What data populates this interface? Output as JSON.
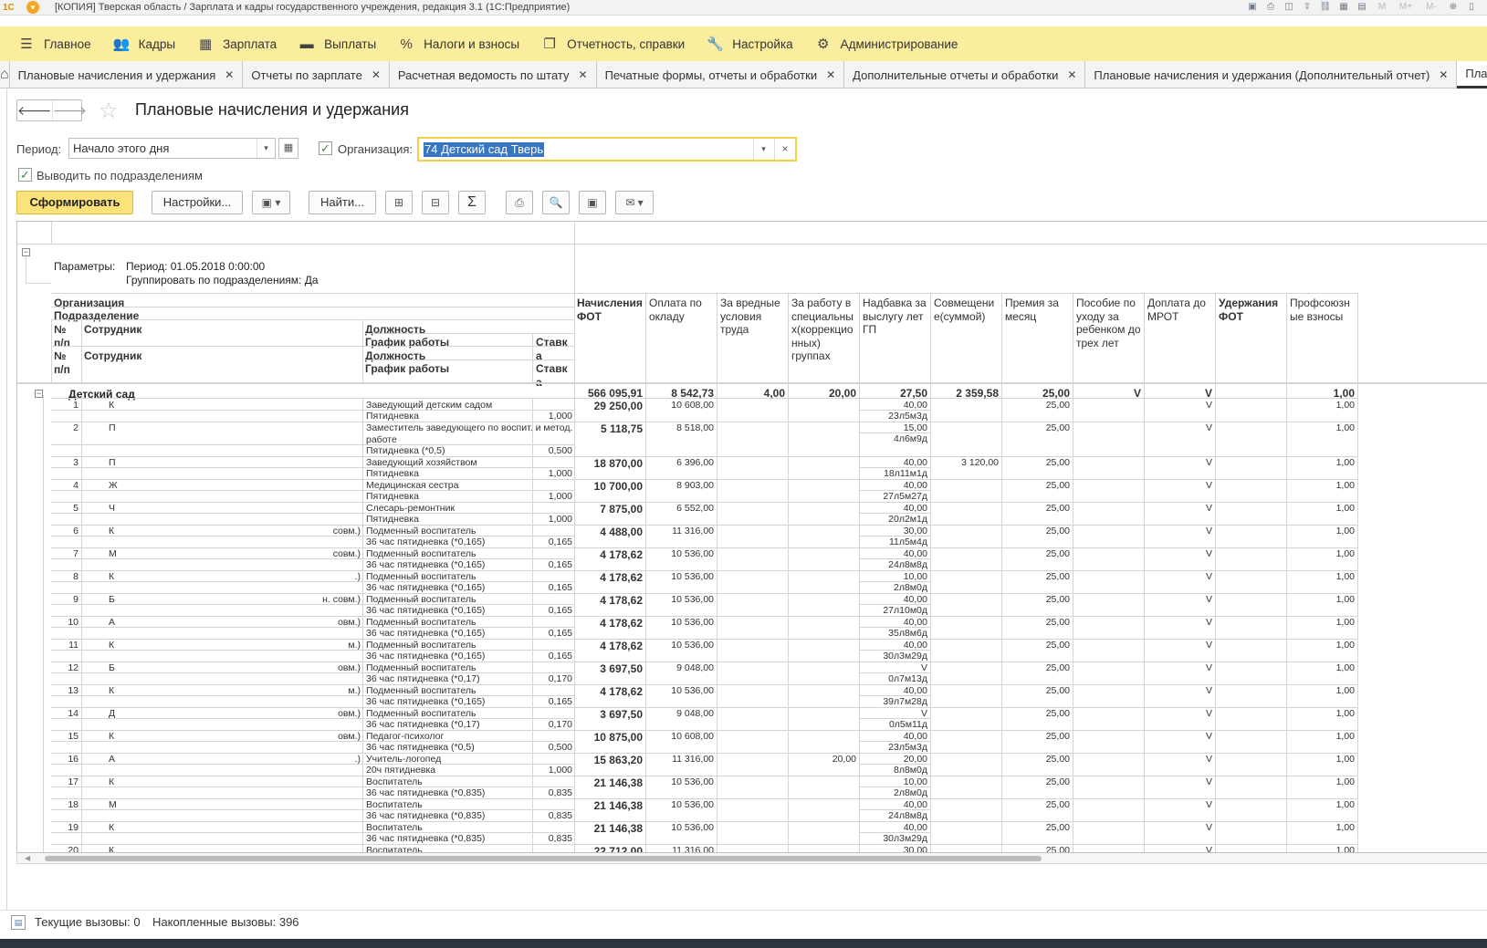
{
  "window": {
    "title": "[КОПИЯ] Тверская область / Зарплата и кадры государственного учреждения, редакция 3.1  (1С:Предприятие)",
    "logo": "1С",
    "toolbar_labels": {
      "m": "M",
      "mplus": "M+",
      "mminus": "M-"
    }
  },
  "main_menu": [
    {
      "label": "Главное",
      "icon": "hamburger-icon"
    },
    {
      "label": "Кадры",
      "icon": "people-icon"
    },
    {
      "label": "Зарплата",
      "icon": "calculator-icon"
    },
    {
      "label": "Выплаты",
      "icon": "wallet-icon"
    },
    {
      "label": "Налоги и взносы",
      "icon": "percent-icon"
    },
    {
      "label": "Отчетность, справки",
      "icon": "report-icon"
    },
    {
      "label": "Настройка",
      "icon": "wrench-icon"
    },
    {
      "label": "Администрирование",
      "icon": "gear-icon"
    }
  ],
  "tabs": [
    {
      "label": "Плановые начисления и удержания"
    },
    {
      "label": "Отчеты по зарплате"
    },
    {
      "label": "Расчетная ведомость по штату"
    },
    {
      "label": "Печатные формы, отчеты и обработки"
    },
    {
      "label": "Дополнительные отчеты и обработки"
    },
    {
      "label": "Плановые начисления и удержания (Дополнительный отчет)"
    },
    {
      "label": "Планов"
    }
  ],
  "form": {
    "title": "Плановые начисления и удержания",
    "period_label": "Период:",
    "period_value": "Начало этого дня",
    "org_label": "Организация:",
    "org_value": "74 Детский сад Тверь",
    "by_department_label": "Выводить по подразделениям"
  },
  "buttons": {
    "generate": "Сформировать",
    "settings": "Настройки...",
    "find": "Найти...",
    "sum_symbol": "Σ"
  },
  "report": {
    "params_label": "Параметры:",
    "params_period": "Период: 01.05.2018 0:00:00",
    "params_group": "Группировать по подразделениям: Да",
    "hdr_left": {
      "org": "Организация",
      "department": "Подразделение",
      "num1": "№ п/п",
      "employee1": "Сотрудник",
      "position1": "Должность",
      "schedule1": "График работы",
      "rate1": "Ставк а",
      "num2": "№ п/п",
      "employee2": "Сотрудник",
      "position2": "Должность",
      "schedule2": "График работы",
      "rate2": "Ставк а"
    },
    "columns": [
      "Начисления ФОТ",
      "Оплата по окладу",
      "За вредные условия труда",
      "За работу в специальны х(коррекцио нных) группах",
      "Надбавка за выслугу лет ГП",
      "Совмещени е(суммой)",
      "Премия за месяц",
      "Пособие по уходу за ребенком до трех лет",
      "Доплата до МРОТ",
      "Удержания ФОТ",
      "Профсоюзн ые взносы"
    ],
    "group": {
      "name": "Детский сад",
      "values": [
        "566 095,91",
        "8 542,73",
        "4,00",
        "20,00",
        "27,50",
        "2 359,58",
        "25,00",
        "V",
        "V",
        "",
        "1,00"
      ]
    },
    "rows": [
      {
        "n": "1",
        "e": "К",
        "p": "Заведующий детским садом",
        "s": "Пятидневка",
        "r": "1,000",
        "v": [
          "29 250,00",
          "10 608,00",
          "",
          "",
          "40,00",
          "",
          "25,00",
          "",
          "V",
          "",
          "1,00"
        ],
        "t": "23л5м3д"
      },
      {
        "n": "2",
        "e": "П",
        "p": "Заместитель заведующего по воспит. и метод. работе",
        "s": "Пятидневка (*0,5)",
        "r": "0,500",
        "v": [
          "5 118,75",
          "8 518,00",
          "",
          "",
          "15,00",
          "",
          "25,00",
          "",
          "V",
          "",
          "1,00"
        ],
        "t": "4л6м9д"
      },
      {
        "n": "3",
        "e": "П",
        "p": "Заведующий хозяйством",
        "s": "Пятидневка",
        "r": "1,000",
        "v": [
          "18 870,00",
          "6 396,00",
          "",
          "",
          "40,00",
          "3 120,00",
          "25,00",
          "",
          "V",
          "",
          "1,00"
        ],
        "t": "18л11м1д"
      },
      {
        "n": "4",
        "e": "Ж",
        "p": "Медицинская сестра",
        "s": "Пятидневка",
        "r": "1,000",
        "v": [
          "10 700,00",
          "8 903,00",
          "",
          "",
          "40,00",
          "",
          "25,00",
          "",
          "V",
          "",
          "1,00"
        ],
        "t": "27л5м27д"
      },
      {
        "n": "5",
        "e": "Ч",
        "p": "Слесарь-ремонтник",
        "s": "Пятидневка",
        "r": "1,000",
        "v": [
          "7 875,00",
          "6 552,00",
          "",
          "",
          "40,00",
          "",
          "25,00",
          "",
          "V",
          "",
          "1,00"
        ],
        "t": "20л2м1д"
      },
      {
        "n": "6",
        "e": "К",
        "x": "совм.)",
        "p": "Подменный воспитатель",
        "s": "36 час пятидневка (*0,165)",
        "r": "0,165",
        "v": [
          "4 488,00",
          "11 316,00",
          "",
          "",
          "30,00",
          "",
          "25,00",
          "",
          "V",
          "",
          "1,00"
        ],
        "t": "11л5м4д"
      },
      {
        "n": "7",
        "e": "М",
        "x": "совм.)",
        "p": "Подменный воспитатель",
        "s": "36 час пятидневка (*0,165)",
        "r": "0,165",
        "v": [
          "4 178,62",
          "10 536,00",
          "",
          "",
          "40,00",
          "",
          "25,00",
          "",
          "V",
          "",
          "1,00"
        ],
        "t": "24л8м8д"
      },
      {
        "n": "8",
        "e": "К",
        "x": ".)",
        "p": "Подменный воспитатель",
        "s": "36 час пятидневка (*0,165)",
        "r": "0,165",
        "v": [
          "4 178,62",
          "10 536,00",
          "",
          "",
          "10,00",
          "",
          "25,00",
          "",
          "V",
          "",
          "1,00"
        ],
        "t": "2л8м0д"
      },
      {
        "n": "9",
        "e": "Б",
        "x": "н. совм.)",
        "p": "Подменный воспитатель",
        "s": "36 час пятидневка (*0,165)",
        "r": "0,165",
        "v": [
          "4 178,62",
          "10 536,00",
          "",
          "",
          "40,00",
          "",
          "25,00",
          "",
          "V",
          "",
          "1,00"
        ],
        "t": "27л10м0д"
      },
      {
        "n": "10",
        "e": "А",
        "x": "овм.)",
        "p": "Подменный воспитатель",
        "s": "36 час пятидневка (*0,165)",
        "r": "0,165",
        "v": [
          "4 178,62",
          "10 536,00",
          "",
          "",
          "40,00",
          "",
          "25,00",
          "",
          "V",
          "",
          "1,00"
        ],
        "t": "35л8м6д"
      },
      {
        "n": "11",
        "e": "К",
        "x": "м.)",
        "p": "Подменный воспитатель",
        "s": "36 час пятидневка (*0,165)",
        "r": "0,165",
        "v": [
          "4 178,62",
          "10 536,00",
          "",
          "",
          "40,00",
          "",
          "25,00",
          "",
          "V",
          "",
          "1,00"
        ],
        "t": "30л3м29д"
      },
      {
        "n": "12",
        "e": "Б",
        "x": "овм.)",
        "p": "Подменный воспитатель",
        "s": "36 час пятидневка (*0,17)",
        "r": "0,170",
        "v": [
          "3 697,50",
          "9 048,00",
          "",
          "",
          "V",
          "",
          "25,00",
          "",
          "V",
          "",
          "1,00"
        ],
        "t": "0л7м13д"
      },
      {
        "n": "13",
        "e": "К",
        "x": "м.)",
        "p": "Подменный воспитатель",
        "s": "36 час пятидневка (*0,165)",
        "r": "0,165",
        "v": [
          "4 178,62",
          "10 536,00",
          "",
          "",
          "40,00",
          "",
          "25,00",
          "",
          "V",
          "",
          "1,00"
        ],
        "t": "39л7м28д"
      },
      {
        "n": "14",
        "e": "Д",
        "x": "овм.)",
        "p": "Подменный воспитатель",
        "s": "36 час пятидневка (*0,17)",
        "r": "0,170",
        "v": [
          "3 697,50",
          "9 048,00",
          "",
          "",
          "V",
          "",
          "25,00",
          "",
          "V",
          "",
          "1,00"
        ],
        "t": "0л5м11д"
      },
      {
        "n": "15",
        "e": "К",
        "x": "овм.)",
        "p": "Педагог-психолог",
        "s": "36 час пятидневка (*0,5)",
        "r": "0,500",
        "v": [
          "10 875,00",
          "10 608,00",
          "",
          "",
          "40,00",
          "",
          "25,00",
          "",
          "V",
          "",
          "1,00"
        ],
        "t": "23л5м3д"
      },
      {
        "n": "16",
        "e": "А",
        "x": ".)",
        "p": "Учитель-логопед",
        "s": "20ч пятидневка",
        "r": "1,000",
        "v": [
          "15 863,20",
          "11 316,00",
          "",
          "20,00",
          "20,00",
          "",
          "25,00",
          "",
          "V",
          "",
          "1,00"
        ],
        "t": "8л8м0д"
      },
      {
        "n": "17",
        "e": "К",
        "p": "Воспитатель",
        "s": "36 час пятидневка (*0,835)",
        "r": "0,835",
        "v": [
          "21 146,38",
          "10 536,00",
          "",
          "",
          "10,00",
          "",
          "25,00",
          "",
          "V",
          "",
          "1,00"
        ],
        "t": "2л8м0д"
      },
      {
        "n": "18",
        "e": "М",
        "p": "Воспитатель",
        "s": "36 час пятидневка (*0,835)",
        "r": "0,835",
        "v": [
          "21 146,38",
          "10 536,00",
          "",
          "",
          "40,00",
          "",
          "25,00",
          "",
          "V",
          "",
          "1,00"
        ],
        "t": "24л8м8д"
      },
      {
        "n": "19",
        "e": "К",
        "p": "Воспитатель",
        "s": "36 час пятидневка (*0,835)",
        "r": "0,835",
        "v": [
          "21 146,38",
          "10 536,00",
          "",
          "",
          "40,00",
          "",
          "25,00",
          "",
          "V",
          "",
          "1,00"
        ],
        "t": "30л3м29д"
      },
      {
        "n": "20",
        "e": "К",
        "p": "Воспитатель",
        "s": "",
        "r": "",
        "v": [
          "22 712,00",
          "11 316,00",
          "",
          "",
          "30,00",
          "",
          "25,00",
          "",
          "V",
          "",
          "1,00"
        ],
        "t": ""
      }
    ]
  },
  "status": {
    "current_calls": "Текущие вызовы: 0",
    "accumulated_calls": "Накопленные вызовы: 396"
  }
}
